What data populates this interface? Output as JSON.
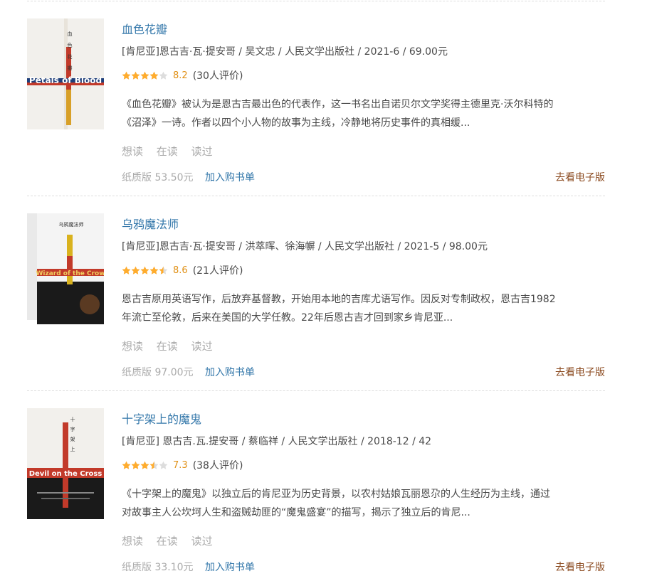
{
  "books": [
    {
      "title": "血色花瓣",
      "pub": "[肯尼亚]恩古吉·瓦·提安哥 / 吴文忠 / 人民文学出版社 / 2021-6 / 69.00元",
      "rating_value": 4.0,
      "score": "8.2",
      "count": "(30人评价)",
      "desc_line1": "《血色花瓣》被认为是恩古吉最出色的代表作，这一书名出自诺贝尔文学奖得主德里克·沃尔科特的",
      "desc_line2": "《沼泽》一诗。作者以四个小人物的故事为主线，冷静地将历史事件的真相缓...",
      "want": "想读",
      "reading": "在读",
      "read": "读过",
      "price": "纸质版 53.50元",
      "add_list": "加入购书单",
      "ebook": "去看电子版",
      "cover_text": "Petals of Blood",
      "cover_cn": "血色花瓣"
    },
    {
      "title": "乌鸦魔法师",
      "pub": "[肯尼亚]恩古吉·瓦·提安哥 / 洪萃晖、徐海幈 / 人民文学出版社 / 2021-5 / 98.00元",
      "rating_value": 4.5,
      "score": "8.6",
      "count": "(21人评价)",
      "desc_line1": "恩古吉原用英语写作，后放弃基督教，开始用本地的吉库尤语写作。因反对专制政权，恩古吉1982",
      "desc_line2": "年流亡至伦敦，后来在美国的大学任教。22年后恩古吉才回到家乡肯尼亚...",
      "want": "想读",
      "reading": "在读",
      "read": "读过",
      "price": "纸质版 97.00元",
      "add_list": "加入购书单",
      "ebook": "去看电子版",
      "cover_text": "Wizard of the Crow",
      "cover_cn": "乌鸦魔法师"
    },
    {
      "title": "十字架上的魔鬼",
      "pub": "[肯尼亚] 恩古吉.瓦.提安哥 / 蔡临祥 / 人民文学出版社 / 2018-12 / 42",
      "rating_value": 3.5,
      "score": "7.3",
      "count": "(38人评价)",
      "desc_line1": "《十字架上的魔鬼》以独立后的肯尼亚为历史背景，以农村姑娘瓦丽恩尕的人生经历为主线，通过",
      "desc_line2": "对故事主人公坎坷人生和盗贼劫匪的“魔鬼盛宴”的描写，揭示了独立后的肯尼...",
      "want": "想读",
      "reading": "在读",
      "read": "读过",
      "price": "纸质版 33.10元",
      "add_list": "加入购书单",
      "ebook": "去看电子版",
      "cover_text": "Devil on the Cross",
      "cover_cn": "十字架上的魔鬼"
    }
  ],
  "colors": {
    "link": "#3377aa",
    "star": "#ffac2d",
    "star_empty": "#dddddd",
    "ebook": "#8b4a1f",
    "muted": "#aaaaaa"
  }
}
